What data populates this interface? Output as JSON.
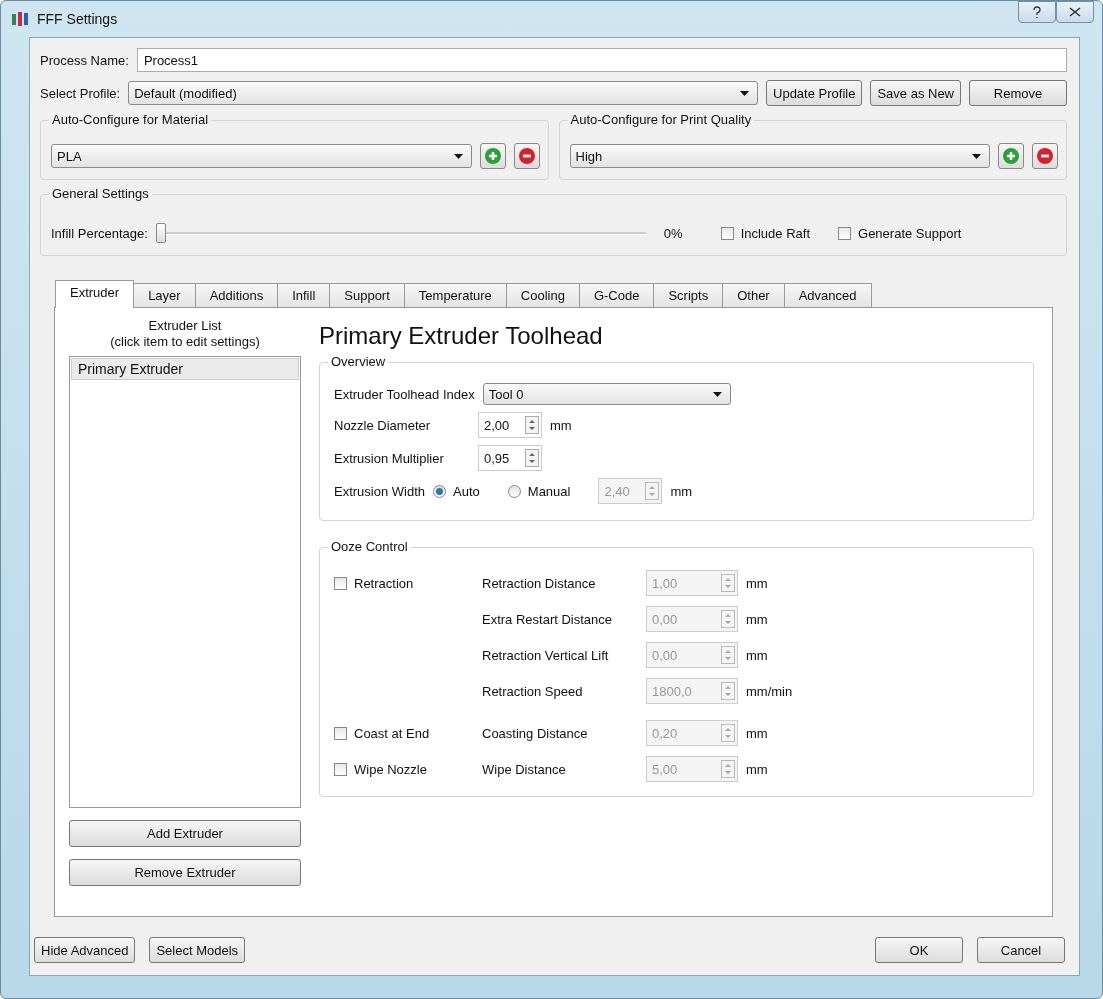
{
  "window": {
    "title": "FFF Settings"
  },
  "process_name": {
    "label": "Process Name:",
    "value": "Process1"
  },
  "profile": {
    "label": "Select Profile:",
    "value": "Default (modified)",
    "buttons": [
      "Update Profile",
      "Save as New",
      "Remove"
    ]
  },
  "auto_configure": [
    {
      "title": "Auto-Configure for Material",
      "value": "PLA"
    },
    {
      "title": "Auto-Configure for Print Quality",
      "value": "High"
    }
  ],
  "general": {
    "title": "General Settings",
    "infill_label": "Infill Percentage:",
    "level": 0,
    "reading": "0%",
    "checkboxes": [
      {
        "label": "Include Raft",
        "checked": false
      },
      {
        "label": "Generate Support",
        "checked": false
      }
    ]
  },
  "tabs": [
    {
      "label": "Extruder",
      "selected": true
    },
    {
      "label": "Layer",
      "selected": false
    },
    {
      "label": "Additions",
      "selected": false
    },
    {
      "label": "Infill",
      "selected": false
    },
    {
      "label": "Support",
      "selected": false
    },
    {
      "label": "Temperature",
      "selected": false
    },
    {
      "label": "Cooling",
      "selected": false
    },
    {
      "label": "G-Code",
      "selected": false
    },
    {
      "label": "Scripts",
      "selected": false
    },
    {
      "label": "Other",
      "selected": false
    },
    {
      "label": "Advanced",
      "selected": false
    }
  ],
  "extruder_list": {
    "heading": [
      "Extruder List",
      "(click item to edit settings)"
    ],
    "items": [
      {
        "label": "Primary Extruder",
        "selected": true
      }
    ],
    "buttons": [
      "Add Extruder",
      "Remove Extruder"
    ]
  },
  "heading": "Primary Extruder Toolhead",
  "overview": {
    "title": "Overview",
    "toolhead": {
      "label": "Extruder Toolhead Index",
      "value": "Tool 0"
    },
    "nozzle": {
      "label": "Nozzle Diameter",
      "value": "2,00",
      "unit": "mm"
    },
    "multiplier": {
      "label": "Extrusion Multiplier",
      "value": "0,95"
    },
    "width": {
      "label": "Extrusion Width",
      "options": [
        {
          "label": "Auto",
          "selected": true
        },
        {
          "label": "Manual",
          "selected": false
        }
      ],
      "value": "2,40",
      "unit": "mm",
      "disabled": true
    }
  },
  "ooze": {
    "title": "Ooze Control",
    "rows": [
      {
        "checkbox": {
          "label": "Retraction",
          "checked": false
        },
        "label": "Retraction Distance",
        "value": "1,00",
        "unit": "mm",
        "disabled": true
      },
      {
        "label": "Extra Restart Distance",
        "value": "0,00",
        "unit": "mm",
        "disabled": true
      },
      {
        "label": "Retraction Vertical Lift",
        "value": "0,00",
        "unit": "mm",
        "disabled": true
      },
      {
        "label": "Retraction Speed",
        "value": "1800,0",
        "unit": "mm/min",
        "disabled": true
      },
      {
        "checkbox": {
          "label": "Coast at End",
          "checked": false
        },
        "label": "Coasting Distance",
        "value": "0,20",
        "unit": "mm",
        "disabled": true
      },
      {
        "checkbox": {
          "label": "Wipe Nozzle",
          "checked": false
        },
        "label": "Wipe Distance",
        "value": "5,00",
        "unit": "mm",
        "disabled": true
      }
    ]
  },
  "footer": {
    "left": [
      "Hide Advanced",
      "Select Models"
    ],
    "right": [
      "OK",
      "Cancel"
    ]
  }
}
